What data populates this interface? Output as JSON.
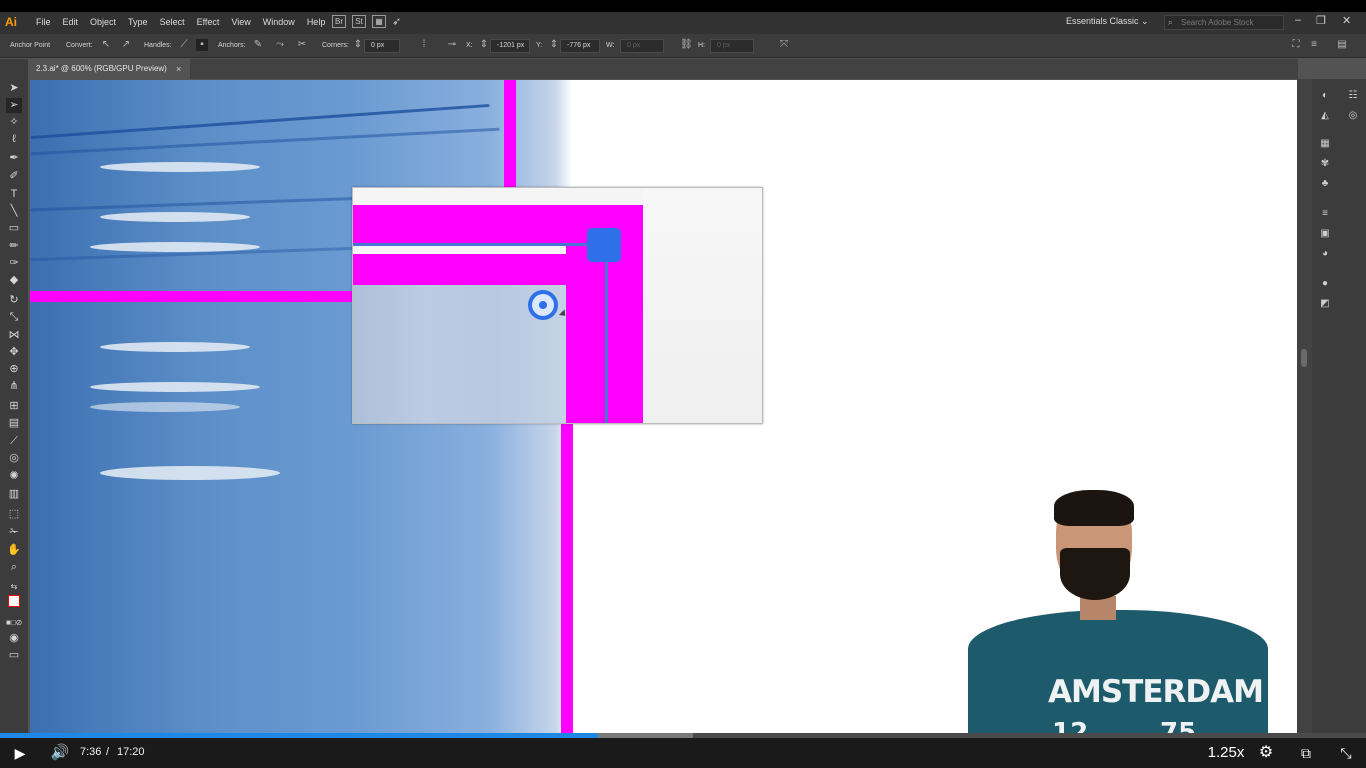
{
  "app": {
    "logo": "Ai",
    "menus": [
      "File",
      "Edit",
      "Object",
      "Type",
      "Select",
      "Effect",
      "View",
      "Window",
      "Help"
    ],
    "bridge_icons": [
      "Br",
      "St"
    ],
    "workspace": "Essentials Classic",
    "search_placeholder": "Search Adobe Stock"
  },
  "control_bar": {
    "anchor_label": "Anchor Point",
    "convert_label": "Convert:",
    "handles_label": "Handles:",
    "anchors_label": "Anchors:",
    "corners_label": "Corners:",
    "corners_value": "0 px",
    "x_label": "X:",
    "x_value": "-1201 px",
    "y_label": "Y:",
    "y_value": "-776 px",
    "w_label": "W:",
    "w_value": "0 px",
    "h_label": "H:",
    "h_value": "0 px"
  },
  "document": {
    "tab_title": "2.3.ai* @ 600% (RGB/GPU Preview)",
    "close_symbol": "×"
  },
  "presenter": {
    "shirt_text": "AMSTERDAM",
    "shirt_num_left": "12",
    "shirt_num_right": "75"
  },
  "player": {
    "current_time": "7:36",
    "separator": "/",
    "duration": "17:20",
    "speed": "1.25x",
    "progress_played": 0.438,
    "progress_buffered": 0.507
  },
  "colors": {
    "accent_magenta": "#ff00ff",
    "anchor_blue": "#2f6fe8",
    "progress_blue": "#1e88e5",
    "ai_orange": "#ff9a00"
  }
}
